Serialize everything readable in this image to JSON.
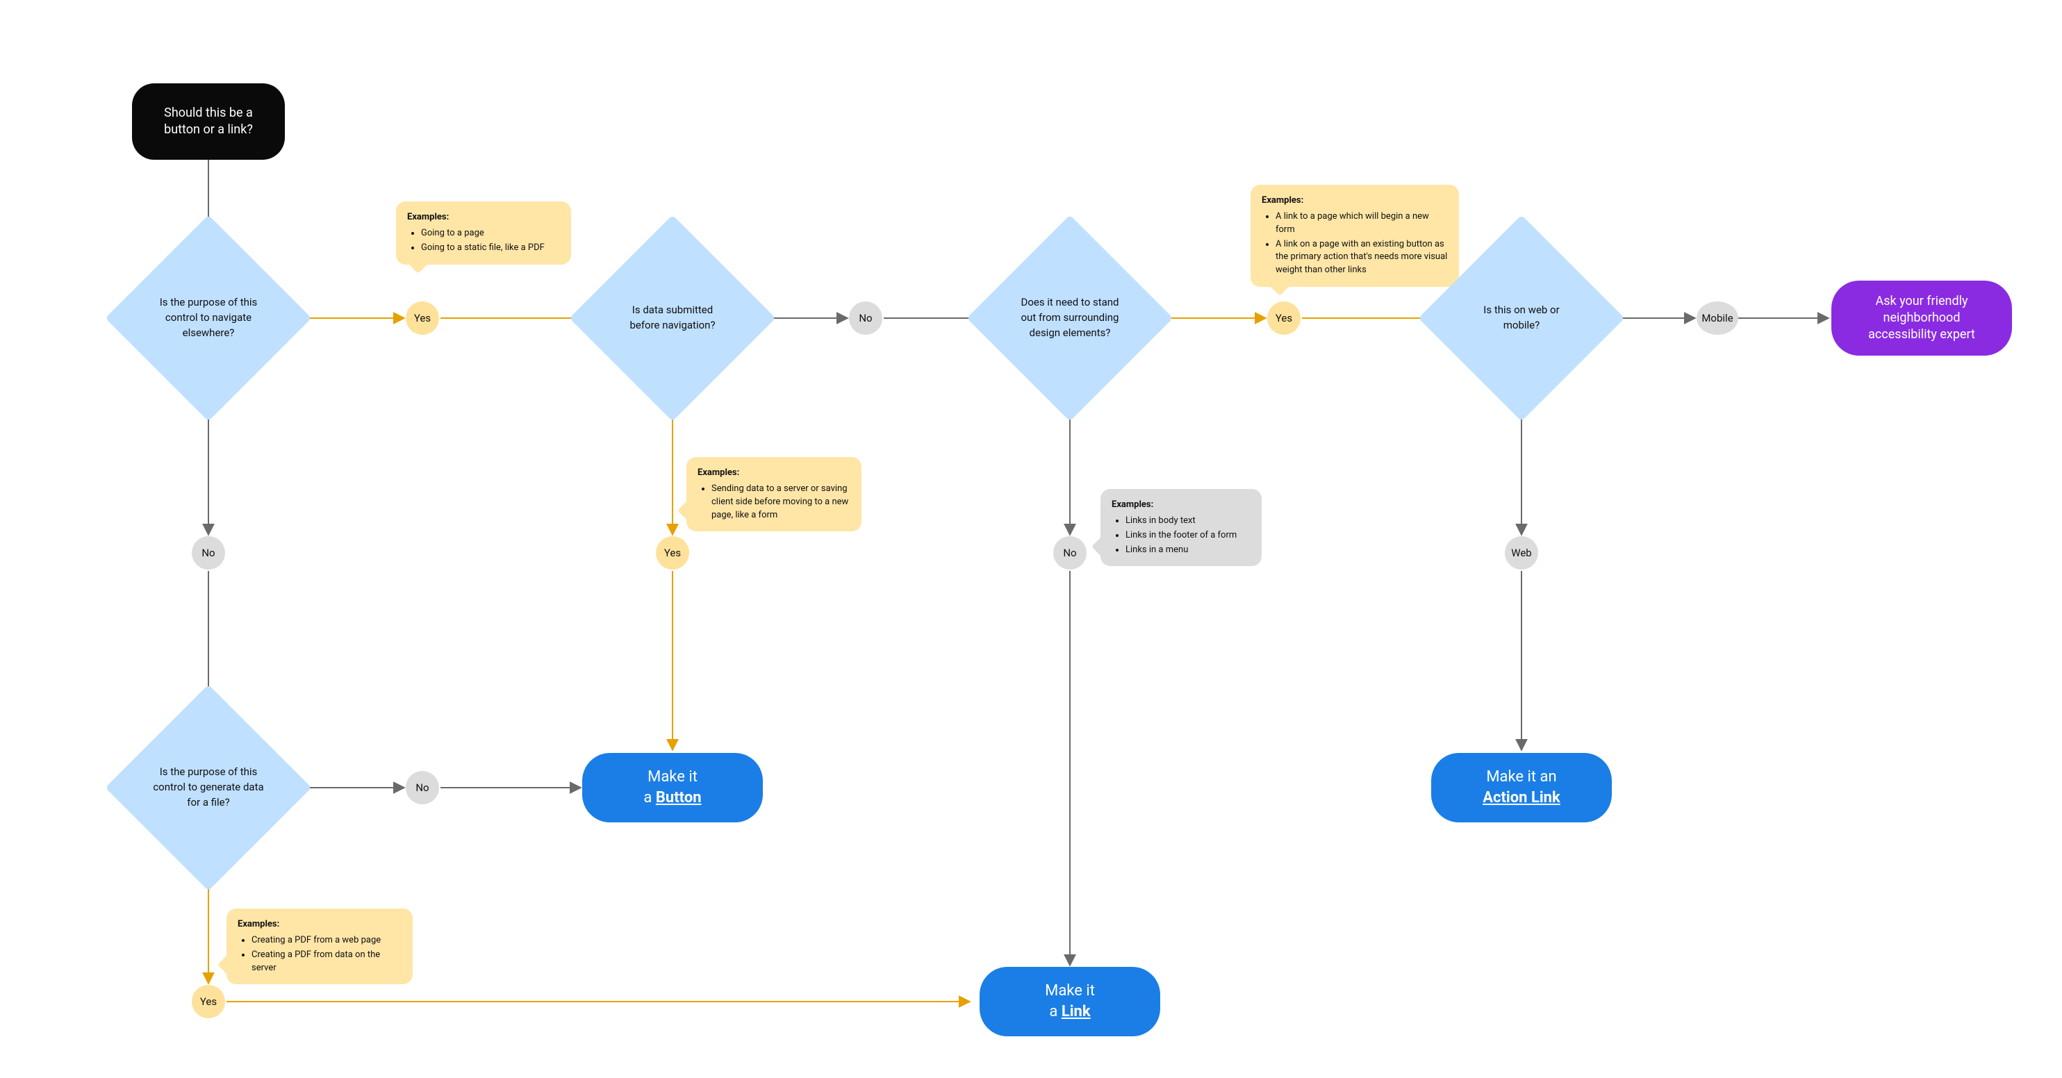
{
  "start": {
    "text": "Should this be a button or a link?"
  },
  "decisions": {
    "q1": "Is the purpose of this control to navigate elsewhere?",
    "q2": "Is data submitted before navigation?",
    "q3": "Does it need to stand out from surrounding design elements?",
    "q4": "Is this on web or mobile?",
    "q5": "Is the purpose of this control to generate data for a file?"
  },
  "answers": {
    "yes": "Yes",
    "no": "No",
    "web": "Web",
    "mobile": "Mobile"
  },
  "callouts": {
    "c1": {
      "head": "Examples:",
      "items": [
        "Going to a page",
        "Going to a static file, like a PDF"
      ]
    },
    "c2": {
      "head": "Examples:",
      "items": [
        "Sending data to a server or saving client side before moving to a new page, like a form"
      ]
    },
    "c3": {
      "head": "Examples:",
      "items": [
        "A link to a page which will begin a new form",
        "A link on a page with an existing button as the primary action that's needs more visual weight than other links"
      ]
    },
    "c4": {
      "head": "Examples:",
      "items": [
        "Links in body text",
        "Links in the footer of a form",
        "Links in a menu"
      ]
    },
    "c5": {
      "head": "Examples:",
      "items": [
        "Creating a PDF from a web page",
        "Creating a PDF from data on the server"
      ]
    }
  },
  "terminals": {
    "t_button": {
      "pre": "Make it",
      "line2a": "a ",
      "key": "Button"
    },
    "t_link": {
      "pre": "Make it",
      "line2a": "a ",
      "key": "Link"
    },
    "t_action": {
      "pre": "Make it an",
      "line2a": "",
      "key": "Action Link"
    },
    "t_expert": {
      "text": "Ask your friendly neighborhood accessibility expert"
    }
  },
  "colors": {
    "diamond": "#bfe0ff",
    "yesCircle": "#fee29b",
    "greyCircle": "#dcdcdc",
    "calloutYellow": "#ffe6a7",
    "terminalBlue": "#1a7ee6",
    "terminalPurple": "#8a2be2",
    "edgeYes": "#e6a100",
    "edgeNo": "#6a6a6a"
  }
}
